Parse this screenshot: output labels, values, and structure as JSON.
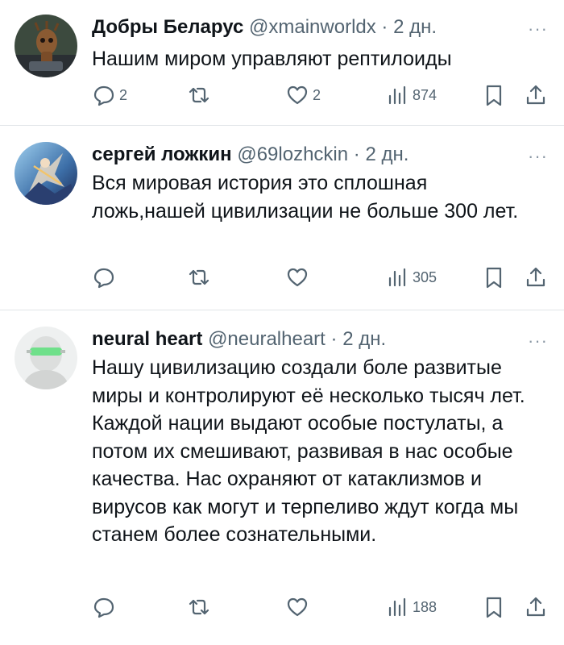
{
  "tweets": [
    {
      "name": "Добры Беларус",
      "handle": "@xmainworldx",
      "dot": "·",
      "time": "2 дн.",
      "text": "Нашим миром управляют рептилоиды",
      "replies": "2",
      "retweets": "",
      "likes": "2",
      "views": "874",
      "avatar_icon": "groot-avatar"
    },
    {
      "name": "сергей ложкин",
      "handle": "@69lozhckin",
      "dot": "·",
      "time": "2 дн.",
      "text": "Вся мировая история это сплошная ложь,нашей цивилизации не больше 300 лет.",
      "replies": "",
      "retweets": "",
      "likes": "",
      "views": "305",
      "avatar_icon": "fantasy-warrior-avatar"
    },
    {
      "name": "neural heart",
      "handle": "@neuralheart",
      "dot": "·",
      "time": "2 дн.",
      "text": "Нашу цивилизацию создали боле развитые миры и контролируют её несколько тысяч лет. Каждой нации выдают особые постулаты, а потом их смешивают, развивая в нас особые качества. Нас охраняют от катаклизмов и вирусов как могут и терпеливо ждут когда мы станем более сознательными.",
      "replies": "",
      "retweets": "",
      "likes": "",
      "views": "188",
      "avatar_icon": "robot-visor-avatar"
    }
  ],
  "more_glyph": "···",
  "colors": {
    "secondary": "#536471",
    "divider": "#e1e5e8",
    "text": "#0f1419"
  }
}
